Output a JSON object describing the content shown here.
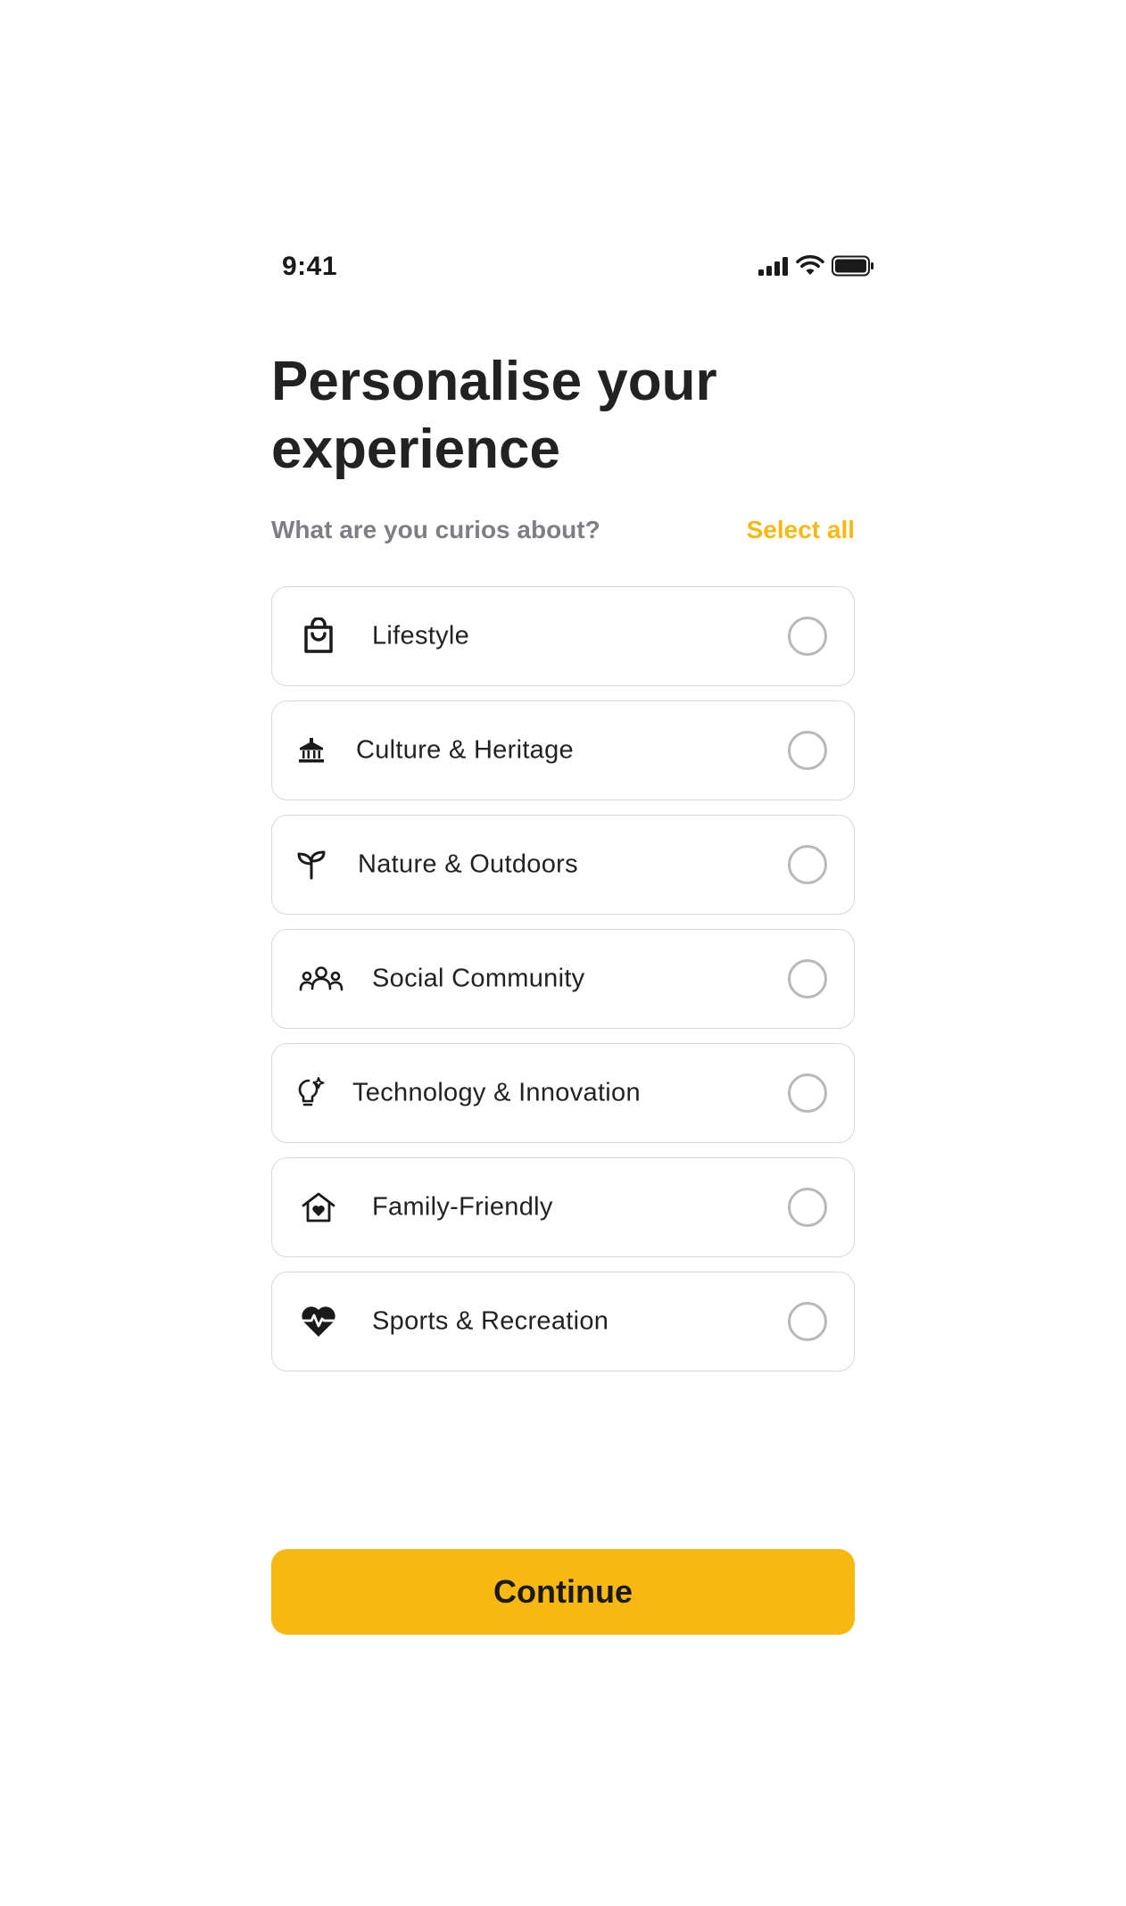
{
  "status_bar": {
    "time": "9:41",
    "icons": [
      "signal-icon",
      "wifi-icon",
      "battery-icon"
    ]
  },
  "header": {
    "title": "Personalise your experience"
  },
  "prompt": {
    "question": "What are you curios about?",
    "select_all_label": "Select all"
  },
  "options": [
    {
      "label": "Lifestyle",
      "icon": "shopping-bag-icon",
      "selected": false
    },
    {
      "label": "Culture & Heritage",
      "icon": "museum-icon",
      "selected": false
    },
    {
      "label": "Nature & Outdoors",
      "icon": "sprout-icon",
      "selected": false
    },
    {
      "label": "Social Community",
      "icon": "people-group-icon",
      "selected": false
    },
    {
      "label": "Technology & Innovation",
      "icon": "lightbulb-icon",
      "selected": false
    },
    {
      "label": "Family-Friendly",
      "icon": "home-heart-icon",
      "selected": false
    },
    {
      "label": "Sports & Recreation",
      "icon": "heart-pulse-icon",
      "selected": false
    }
  ],
  "footer": {
    "continue_label": "Continue"
  },
  "colors": {
    "accent": "#F8B812",
    "text_primary": "#222222",
    "text_secondary": "#7D7F85",
    "border": "#D6D7DA"
  }
}
